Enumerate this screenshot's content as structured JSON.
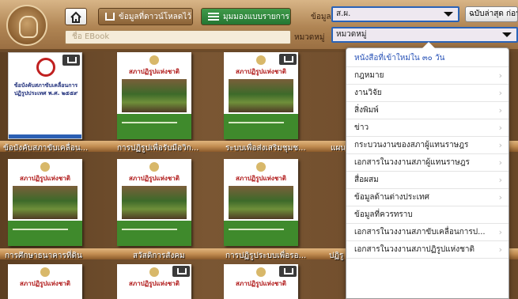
{
  "toolbar": {
    "download_label": "ข้อมูลที่ดาวน์โหลดไว้",
    "list_view_label": "มุมมองแบบรายการ",
    "search_placeholder": "ชื่อ EBook"
  },
  "filters": {
    "data_label": "ข้อมูล",
    "data_value": "ส.ผ.",
    "category_label": "หมวดหมู่",
    "category_value": "หมวดหมู่",
    "sort_label": "ฉบับล่าสุด ก่อน"
  },
  "books": {
    "row1": [
      {
        "title": "ข้อบังคับสภาขับเคลื่อนการปฏิรูปประเทศ พ.ศ. ๒๕๕๙",
        "caption": "ข้อบังคับสภาขับเคลื่อน..."
      },
      {
        "title": "สภาปฏิรูปแห่งชาติ",
        "caption": "การปฏิรูปเพื่อรับมือวิก..."
      },
      {
        "title": "สภาปฏิรูปแห่งชาติ",
        "caption": "ระบบเพื่อส่งเสริมชุมช..."
      },
      {
        "title": "",
        "caption": "แผน"
      }
    ],
    "row2": [
      {
        "title": "สภาปฏิรูปแห่งชาติ",
        "caption": "การศึกษาธนาคารที่ดิน"
      },
      {
        "title": "สภาปฏิรูปแห่งชาติ",
        "caption": "สวัสดิการสังคม"
      },
      {
        "title": "สภาปฏิรูปแห่งชาติ",
        "caption": "การปฏิรูประบบเพื่อรอ..."
      },
      {
        "title": "",
        "caption": "ปฏิรู"
      }
    ],
    "row3": [
      {
        "title": "สภาปฏิรูปแห่งชาติ"
      },
      {
        "title": "สภาปฏิรูปแห่งชาติ"
      },
      {
        "title": "สภาปฏิรูปแห่งชาติ"
      }
    ]
  },
  "dropdown": {
    "items": [
      "หนังสือที่เข้าใหม่ใน ๓๐ วัน",
      "กฎหมาย",
      "งานวิจัย",
      "สิ่งพิมพ์",
      "ข่าว",
      "กระบวนงานของสภาผู้แทนราษฎร",
      "เอกสารในวงงานสภาผู้แทนราษฎร",
      "สื่อผสม",
      "ข้อมูลด้านต่างประเทศ",
      "ข้อมูลที่ควรทราบ",
      "เอกสารในวงงานสภาขับเคลื่อนการป...",
      "เอกสารในวงงานสภาปฏิรูปแห่งชาติ"
    ],
    "chevron": "›"
  }
}
